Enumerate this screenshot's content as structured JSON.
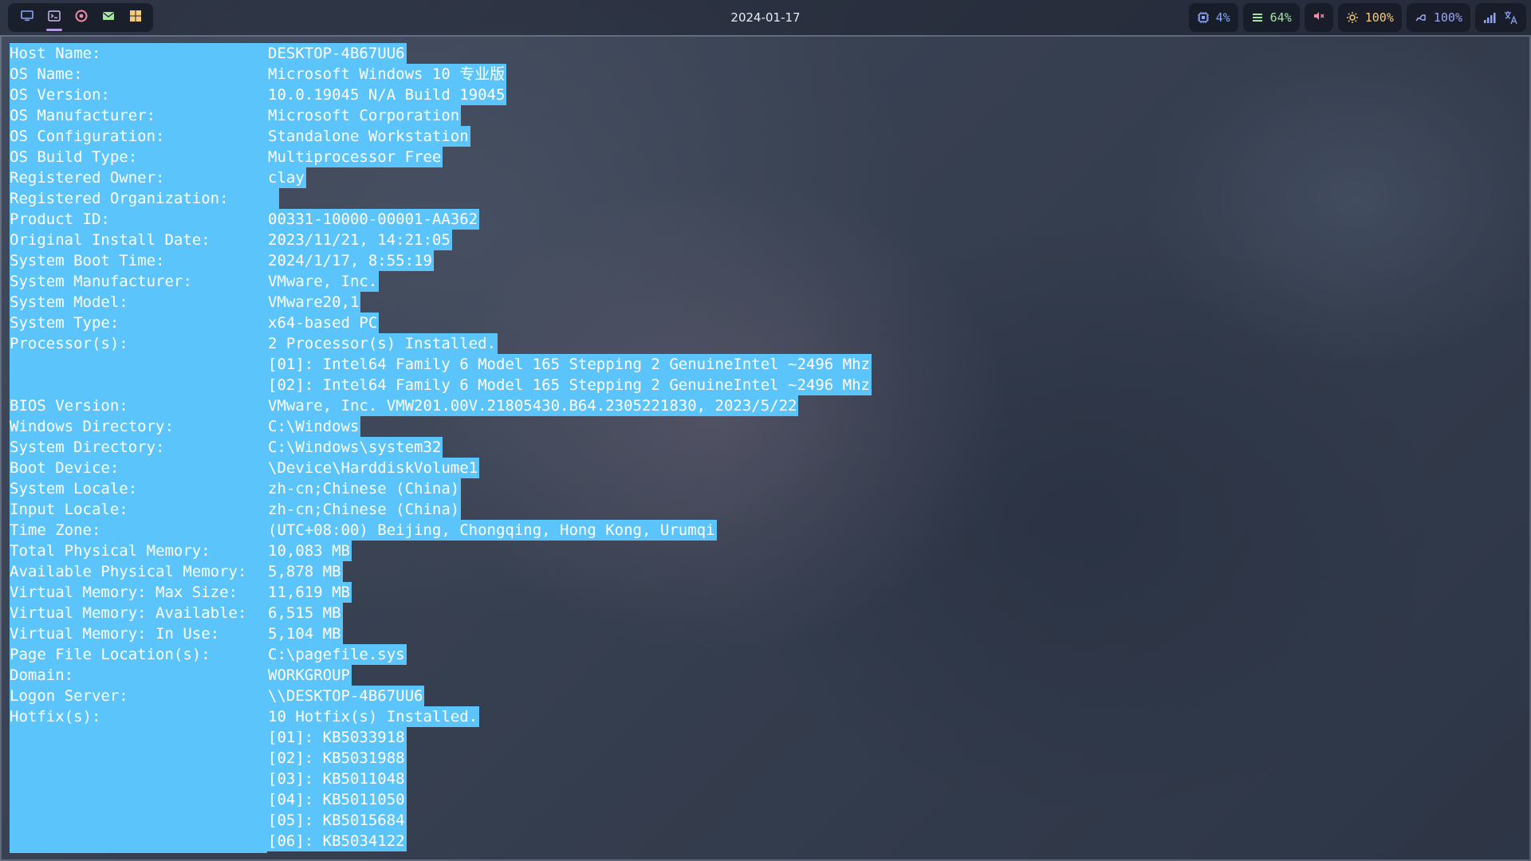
{
  "topbar": {
    "workspaces": [
      {
        "name": "monitor-icon",
        "active": false
      },
      {
        "name": "terminal-icon",
        "active": true
      },
      {
        "name": "chrome-icon",
        "active": false
      },
      {
        "name": "mail-icon",
        "active": false
      },
      {
        "name": "windows-icon",
        "active": false
      }
    ],
    "date": "2024-01-17",
    "status": {
      "cpu": "4%",
      "memory": "64%",
      "brightness": "100%",
      "battery": "100%"
    },
    "colors": {
      "active_indicator": "#b39ddb",
      "cpu": "#8aa4f5",
      "memory": "#a6e3a1",
      "volume_muted": "#f38ba8",
      "brightness": "#f9c97a",
      "battery": "#9aa5f5"
    }
  },
  "terminal": {
    "selection_color": "#5bc4fb",
    "rows": [
      {
        "k": "Host Name:",
        "v": "DESKTOP-4B67UU6"
      },
      {
        "k": "OS Name:",
        "v": "Microsoft Windows 10 专业版"
      },
      {
        "k": "OS Version:",
        "v": "10.0.19045 N/A Build 19045"
      },
      {
        "k": "OS Manufacturer:",
        "v": "Microsoft Corporation"
      },
      {
        "k": "OS Configuration:",
        "v": "Standalone Workstation"
      },
      {
        "k": "OS Build Type:",
        "v": "Multiprocessor Free"
      },
      {
        "k": "Registered Owner:",
        "v": "clay"
      },
      {
        "k": "Registered Organization:",
        "v": ""
      },
      {
        "k": "Product ID:",
        "v": "00331-10000-00001-AA362"
      },
      {
        "k": "Original Install Date:",
        "v": "2023/11/21, 14:21:05"
      },
      {
        "k": "System Boot Time:",
        "v": "2024/1/17, 8:55:19"
      },
      {
        "k": "System Manufacturer:",
        "v": "VMware, Inc."
      },
      {
        "k": "System Model:",
        "v": "VMware20,1"
      },
      {
        "k": "System Type:",
        "v": "x64-based PC"
      },
      {
        "k": "Processor(s):",
        "v": "2 Processor(s) Installed."
      },
      {
        "k": "",
        "v": "[01]: Intel64 Family 6 Model 165 Stepping 2 GenuineIntel ~2496 Mhz"
      },
      {
        "k": "",
        "v": "[02]: Intel64 Family 6 Model 165 Stepping 2 GenuineIntel ~2496 Mhz"
      },
      {
        "k": "BIOS Version:",
        "v": "VMware, Inc. VMW201.00V.21805430.B64.2305221830, 2023/5/22"
      },
      {
        "k": "Windows Directory:",
        "v": "C:\\Windows"
      },
      {
        "k": "System Directory:",
        "v": "C:\\Windows\\system32"
      },
      {
        "k": "Boot Device:",
        "v": "\\Device\\HarddiskVolume1"
      },
      {
        "k": "System Locale:",
        "v": "zh-cn;Chinese (China)"
      },
      {
        "k": "Input Locale:",
        "v": "zh-cn;Chinese (China)"
      },
      {
        "k": "Time Zone:",
        "v": "(UTC+08:00) Beijing, Chongqing, Hong Kong, Urumqi"
      },
      {
        "k": "Total Physical Memory:",
        "v": "10,083 MB"
      },
      {
        "k": "Available Physical Memory:",
        "v": "5,878 MB"
      },
      {
        "k": "Virtual Memory: Max Size:",
        "v": "11,619 MB"
      },
      {
        "k": "Virtual Memory: Available:",
        "v": "6,515 MB"
      },
      {
        "k": "Virtual Memory: In Use:",
        "v": "5,104 MB"
      },
      {
        "k": "Page File Location(s):",
        "v": "C:\\pagefile.sys"
      },
      {
        "k": "Domain:",
        "v": "WORKGROUP"
      },
      {
        "k": "Logon Server:",
        "v": "\\\\DESKTOP-4B67UU6"
      },
      {
        "k": "Hotfix(s):",
        "v": "10 Hotfix(s) Installed."
      },
      {
        "k": "",
        "v": "[01]: KB5033918"
      },
      {
        "k": "",
        "v": "[02]: KB5031988"
      },
      {
        "k": "",
        "v": "[03]: KB5011048"
      },
      {
        "k": "",
        "v": "[04]: KB5011050"
      },
      {
        "k": "",
        "v": "[05]: KB5015684"
      },
      {
        "k": "",
        "v": "[06]: KB5034122"
      }
    ]
  }
}
